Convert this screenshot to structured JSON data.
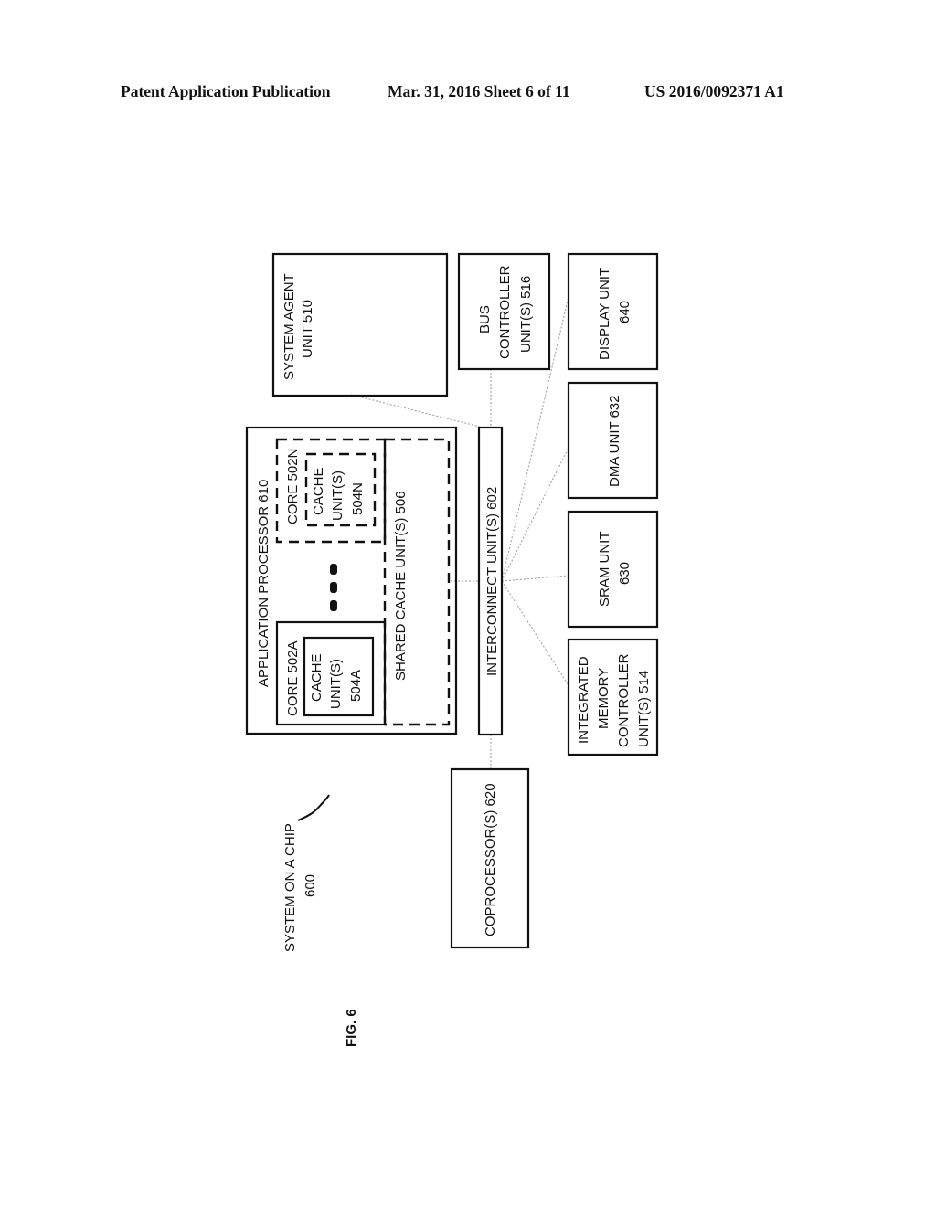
{
  "header": {
    "publication": "Patent Application Publication",
    "date_sheet": "Mar. 31, 2016  Sheet 6 of 11",
    "patent_number": "US 2016/0092371 A1"
  },
  "figure": {
    "label": "FIG. 6",
    "soc_label": [
      "SYSTEM ON A CHIP",
      "600"
    ],
    "application_processor": "APPLICATION PROCESSOR 610",
    "core_a": "CORE 502A",
    "cache_a": [
      "CACHE",
      "UNIT(S)",
      "504A"
    ],
    "core_n": "CORE 502N",
    "cache_n": [
      "CACHE",
      "UNIT(S)",
      "504N"
    ],
    "shared_cache": "SHARED CACHE UNIT(S) 506",
    "interconnect": "INTERCONNECT UNIT(S) 602",
    "system_agent": [
      "SYSTEM AGENT",
      "UNIT 510"
    ],
    "bus_controller": [
      "BUS",
      "CONTROLLER",
      "UNIT(S) 516"
    ],
    "display_unit": [
      "DISPLAY UNIT",
      "640"
    ],
    "dma_unit": "DMA UNIT 632",
    "sram_unit": [
      "SRAM UNIT",
      "630"
    ],
    "imc": [
      "INTEGRATED",
      "MEMORY",
      "CONTROLLER",
      "UNIT(S) 514"
    ],
    "coprocessor": "COPROCESSOR(S) 620"
  }
}
